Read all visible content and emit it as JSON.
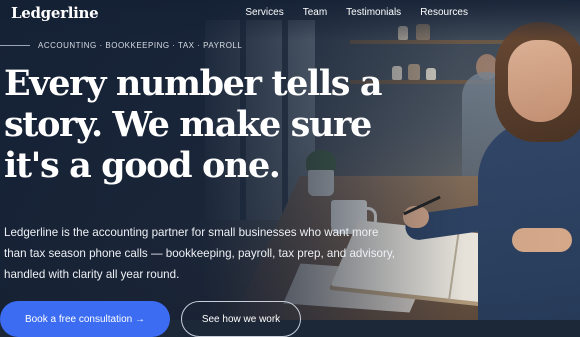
{
  "brand": {
    "logo_text": "Ledgerline"
  },
  "nav": {
    "links": [
      {
        "label": "Services"
      },
      {
        "label": "Team"
      },
      {
        "label": "Testimonials"
      },
      {
        "label": "Resources"
      }
    ]
  },
  "hero": {
    "eyebrow": "ACCOUNTING · BOOKKEEPING · TAX · PAYROLL",
    "headline": "Every number tells a story. We make sure it's a good one.",
    "body": "Ledgerline is the accounting partner for small businesses who want more than tax season phone calls — bookkeeping, payroll, tax prep, and advisory, handled with clarity all year round.",
    "cta_primary": "Book a free consultation →",
    "cta_secondary": "See how we work"
  },
  "colors": {
    "overlay": "#142034",
    "cta_primary_bg": "#3b6cf2",
    "text": "#ffffff"
  }
}
